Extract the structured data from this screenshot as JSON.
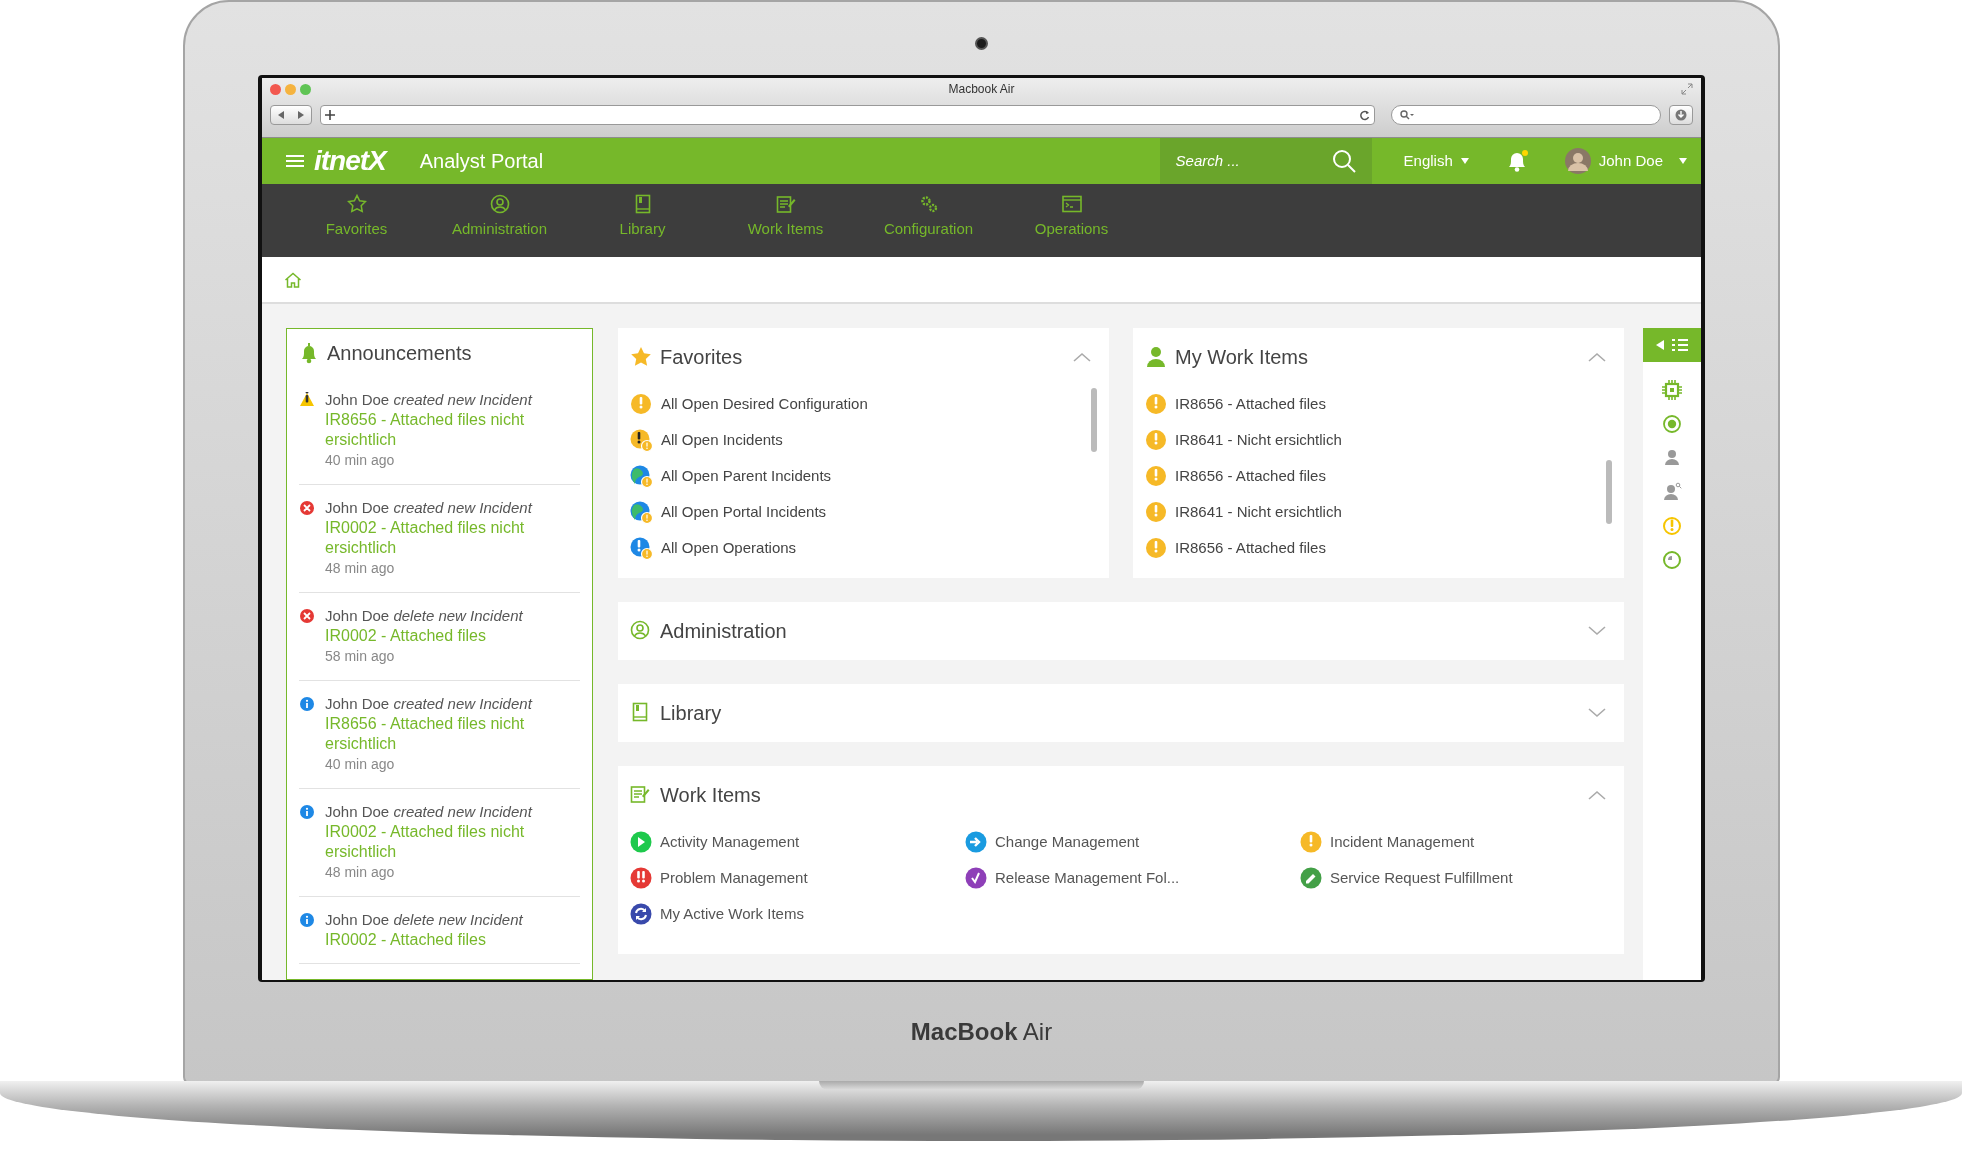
{
  "device": {
    "brand": "**MacBook** Air"
  },
  "browser": {
    "title": "Macbook Air"
  },
  "app": {
    "logo": "itnetX",
    "title": "Analyst Portal",
    "search_placeholder": "Search ...",
    "language": "English",
    "user": "John Doe",
    "notification": true
  },
  "nav": [
    {
      "label": "Favorites"
    },
    {
      "label": "Administration"
    },
    {
      "label": "Library"
    },
    {
      "label": "Work Items"
    },
    {
      "label": "Configuration"
    },
    {
      "label": "Operations"
    }
  ],
  "announcements": {
    "title": "Announcements",
    "items": [
      {
        "kind": "warning",
        "line": "John Doe *created new Incident*",
        "link": "IR8656 - Attached files nicht ersichtlich",
        "time": "40 min ago"
      },
      {
        "kind": "error",
        "line": "John Doe *created new Incident*",
        "link": "IR0002 - Attached files nicht ersichtlich",
        "time": "48 min ago"
      },
      {
        "kind": "error",
        "line": "John Doe *delete new Incident*",
        "link": "IR0002 - Attached files",
        "time": "58 min ago"
      },
      {
        "kind": "info",
        "line": "John Doe *created new Incident*",
        "link": "IR8656 - Attached files nicht ersichtlich",
        "time": "40 min ago"
      },
      {
        "kind": "info",
        "line": "John Doe *created new Incident*",
        "link": "IR0002 - Attached files nicht ersichtlich",
        "time": "48 min ago"
      },
      {
        "kind": "info",
        "line": "John Doe *delete new Incident*",
        "link": "IR0002 - Attached files"
      }
    ]
  },
  "favorites": {
    "title": "Favorites",
    "expanded": true,
    "items": [
      {
        "kind": "warning",
        "label": "All Open Desired Configuration"
      },
      {
        "kind": "incident",
        "label": "All Open Incidents"
      },
      {
        "kind": "globe",
        "label": "All Open Parent Incidents"
      },
      {
        "kind": "globe",
        "label": "All Open Portal Incidents"
      },
      {
        "kind": "operation",
        "label": "All Open Operations"
      }
    ]
  },
  "my_work_items": {
    "title": "My Work Items",
    "expanded": true,
    "items": [
      {
        "label": "IR8656 - Attached files"
      },
      {
        "label": "IR8641 - Nicht ersichtlich"
      },
      {
        "label": "IR8656 - Attached files"
      },
      {
        "label": "IR8641 - Nicht ersichtlich"
      },
      {
        "label": "IR8656 - Attached files"
      }
    ]
  },
  "administration": {
    "title": "Administration",
    "expanded": false
  },
  "library": {
    "title": "Library",
    "expanded": false
  },
  "work_items": {
    "title": "Work Items",
    "expanded": true,
    "items": [
      {
        "kind": "activity",
        "label": "Activity Management"
      },
      {
        "kind": "change",
        "label": "Change Management"
      },
      {
        "kind": "incident",
        "label": "Incident Management"
      },
      {
        "kind": "problem",
        "label": "Problem Management"
      },
      {
        "kind": "release",
        "label": "Release Management Fol..."
      },
      {
        "kind": "service",
        "label": "Service Request Fulfillment"
      },
      {
        "kind": "active",
        "label": "My Active Work Items"
      }
    ]
  }
}
